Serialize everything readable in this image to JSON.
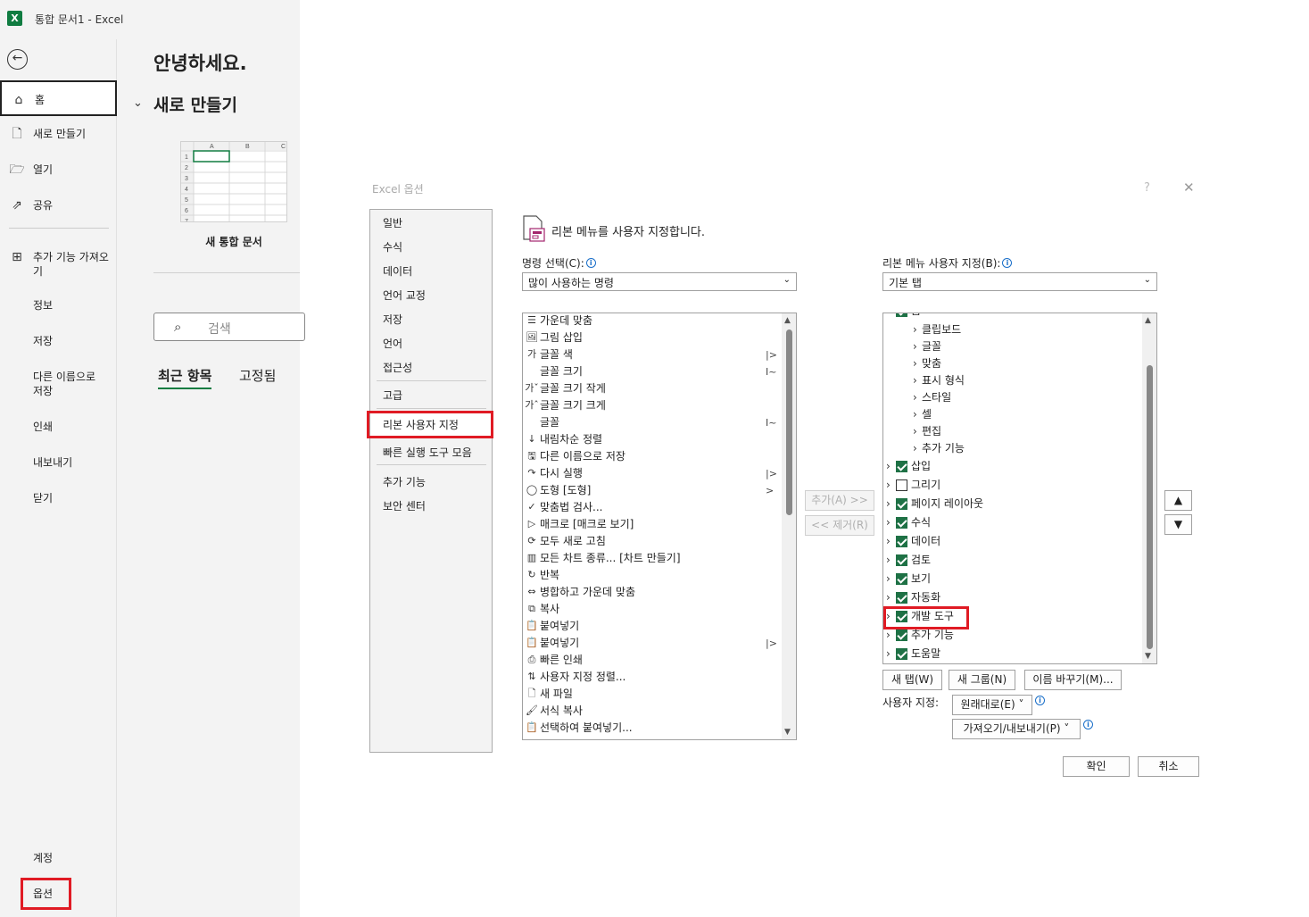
{
  "window": {
    "title": "통합 문서1 - Excel",
    "app_logo": "X"
  },
  "backstage": {
    "nav": {
      "home": "홈",
      "new": "새로 만들기",
      "open": "열기",
      "share": "공유",
      "addins": "추가 기능 가져오기",
      "info": "정보",
      "save": "저장",
      "save_as": "다른 이름으로 저장",
      "print": "인쇄",
      "export": "내보내기",
      "close": "닫기",
      "account": "계정",
      "options": "옵션"
    },
    "greeting": "안녕하세요.",
    "new_section": "새로 만들기",
    "new_workbook": "새 통합 문서",
    "thumb": {
      "cols": [
        "A",
        "B",
        "C"
      ],
      "rows": [
        "1",
        "2",
        "3",
        "4",
        "5",
        "6",
        "7"
      ]
    },
    "search_placeholder": "검색",
    "tabs": {
      "recent": "최근 항목",
      "pinned": "고정됨"
    }
  },
  "dialog": {
    "title": "Excel 옵션",
    "help": "?",
    "close": "✕",
    "categories": [
      "일반",
      "수식",
      "데이터",
      "언어 교정",
      "저장",
      "언어",
      "접근성",
      "고급",
      "리본 사용자 지정",
      "빠른 실행 도구 모음",
      "추가 기능",
      "보안 센터"
    ],
    "heading": "리본 메뉴를 사용자 지정합니다.",
    "choose_label": "명령 선택(C):",
    "choose_value": "많이 사용하는 명령",
    "customize_label": "리본 메뉴 사용자 지정(B):",
    "customize_value": "기본 탭",
    "commands": [
      {
        "icon": "center-align-icon",
        "glyph": "☰",
        "label": "가운데 맞춤",
        "sub": ""
      },
      {
        "icon": "insert-picture-icon",
        "glyph": "🖼",
        "label": "그림 삽입",
        "sub": ""
      },
      {
        "icon": "font-color-icon",
        "glyph": "가",
        "label": "글꼴 색",
        "sub": "|>"
      },
      {
        "icon": "",
        "glyph": "",
        "label": "글꼴 크기",
        "sub": "I~"
      },
      {
        "icon": "decrease-font-icon",
        "glyph": "가ˇ",
        "label": "글꼴 크기 작게",
        "sub": ""
      },
      {
        "icon": "increase-font-icon",
        "glyph": "가ˆ",
        "label": "글꼴 크기 크게",
        "sub": ""
      },
      {
        "icon": "",
        "glyph": "",
        "label": "글꼴",
        "sub": "I~"
      },
      {
        "icon": "sort-descending-icon",
        "glyph": "↓",
        "label": "내림차순 정렬",
        "sub": ""
      },
      {
        "icon": "save-as-icon",
        "glyph": "🖫",
        "label": "다른 이름으로 저장",
        "sub": ""
      },
      {
        "icon": "redo-icon",
        "glyph": "↷",
        "label": "다시 실행",
        "sub": "|>"
      },
      {
        "icon": "shapes-icon",
        "glyph": "◯",
        "label": "도형 [도형]",
        "sub": ">"
      },
      {
        "icon": "spelling-icon",
        "glyph": "✓",
        "label": "맞춤법 검사...",
        "sub": ""
      },
      {
        "icon": "macro-icon",
        "glyph": "▷",
        "label": "매크로 [매크로 보기]",
        "sub": ""
      },
      {
        "icon": "refresh-all-icon",
        "glyph": "⟳",
        "label": "모두 새로 고침",
        "sub": ""
      },
      {
        "icon": "chart-icon",
        "glyph": "▥",
        "label": "모든 차트 종류... [차트 만들기]",
        "sub": ""
      },
      {
        "icon": "repeat-icon",
        "glyph": "↻",
        "label": "반복",
        "sub": ""
      },
      {
        "icon": "merge-center-icon",
        "glyph": "⇔",
        "label": "병합하고 가운데 맞춤",
        "sub": ""
      },
      {
        "icon": "copy-icon",
        "glyph": "⧉",
        "label": "복사",
        "sub": ""
      },
      {
        "icon": "paste-icon",
        "glyph": "📋",
        "label": "붙여넣기",
        "sub": ""
      },
      {
        "icon": "paste-icon",
        "glyph": "📋",
        "label": "붙여넣기",
        "sub": "|>"
      },
      {
        "icon": "quick-print-icon",
        "glyph": "⎙",
        "label": "빠른 인쇄",
        "sub": ""
      },
      {
        "icon": "custom-sort-icon",
        "glyph": "⇅",
        "label": "사용자 지정 정렬...",
        "sub": ""
      },
      {
        "icon": "new-file-icon",
        "glyph": "🗋",
        "label": "새 파일",
        "sub": ""
      },
      {
        "icon": "format-painter-icon",
        "glyph": "🖌",
        "label": "서식 복사",
        "sub": ""
      },
      {
        "icon": "paste-special-icon",
        "glyph": "📋",
        "label": "선택하여 붙여넣기...",
        "sub": ""
      }
    ],
    "add_btn": "추가(A) >>",
    "remove_btn": "<< 제거(R)",
    "tree": {
      "top_partial": "홈",
      "groups": [
        "클립보드",
        "글꼴",
        "맞춤",
        "표시 형식",
        "스타일",
        "셀",
        "편집",
        "추가 기능"
      ],
      "tabs": [
        {
          "label": "삽입",
          "checked": true
        },
        {
          "label": "그리기",
          "checked": false
        },
        {
          "label": "페이지 레이아웃",
          "checked": true
        },
        {
          "label": "수식",
          "checked": true
        },
        {
          "label": "데이터",
          "checked": true
        },
        {
          "label": "검토",
          "checked": true
        },
        {
          "label": "보기",
          "checked": true
        },
        {
          "label": "자동화",
          "checked": true
        },
        {
          "label": "개발 도구",
          "checked": true
        },
        {
          "label": "추가 기능",
          "checked": true
        },
        {
          "label": "도움말",
          "checked": true
        }
      ]
    },
    "move_up": "▲",
    "move_down": "▼",
    "new_tab": "새 탭(W)",
    "new_group": "새 그룹(N)",
    "rename": "이름 바꾸기(M)...",
    "customize_label2": "사용자 지정:",
    "reset": "원래대로(E) ˅",
    "import_export": "가져오기/내보내기(P) ˅",
    "ok": "확인",
    "cancel": "취소"
  }
}
